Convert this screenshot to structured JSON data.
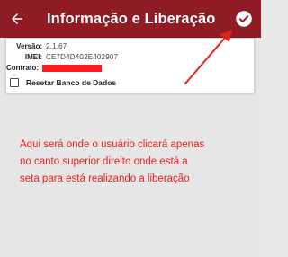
{
  "appbar": {
    "title": "Informação e Liberação",
    "back_icon": "arrow-left-icon",
    "confirm_icon": "check-circle-icon",
    "color": "#8f1b25"
  },
  "info": {
    "version_label": "Versão:",
    "version_value": "2.1.67",
    "imei_label": "IMEI:",
    "imei_value": "CE7D4D402E402907",
    "contract_label": "Contrato:",
    "contract_value_redacted": true
  },
  "reset": {
    "label": "Resetar Banco de Dados",
    "checked": false
  },
  "annotation": {
    "text": "Aqui será onde o usuário clicará apenas\nno canto superior direito onde está a\nseta para está realizando a liberação",
    "color": "#e2231a"
  }
}
